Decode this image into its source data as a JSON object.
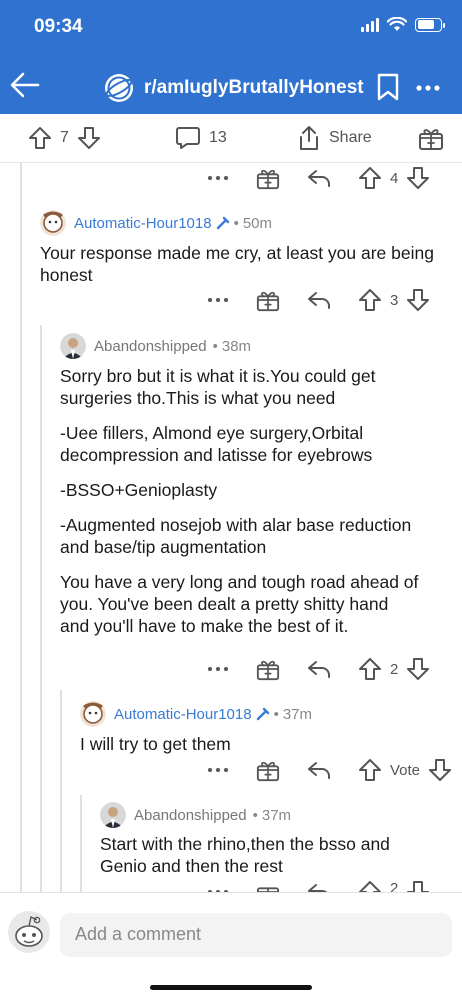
{
  "status": {
    "time": "09:34"
  },
  "header": {
    "subreddit": "r/amIuglyBrutallyHonest"
  },
  "post_actions": {
    "upvotes": "7",
    "comments": "13",
    "share": "Share"
  },
  "comments": [
    {
      "score": "4"
    },
    {
      "author": "Automatic-Hour1018",
      "time": "50m",
      "body": [
        "Your response made me cry, at least you are being honest"
      ],
      "score": "3"
    },
    {
      "author": "Abandonshipped",
      "time": "38m",
      "body": [
        "Sorry bro but it is what it is.You could get surgeries tho.This is what you need",
        "-Uee fillers, Almond eye surgery,Orbital decompression and latisse for eyebrows",
        "-BSSO+Genioplasty",
        "-Augmented nosejob with alar base reduction and base/tip augmentation",
        "You have a very long and tough road ahead of you. You've been dealt a pretty shitty hand and you'll have to make the best of it."
      ],
      "score": "2"
    },
    {
      "author": "Automatic-Hour1018",
      "time": "37m",
      "body": [
        "I will try to get them"
      ],
      "score": "Vote"
    },
    {
      "author": "Abandonshipped",
      "time": "37m",
      "body": [
        "Start with the rhino,then the bsso and Genio and then the rest"
      ],
      "score": "2"
    }
  ],
  "comment_bar": {
    "placeholder": "Add a comment"
  },
  "colors": {
    "header_bg": "#2f72cf",
    "author_blue": "#3a7bd5"
  }
}
